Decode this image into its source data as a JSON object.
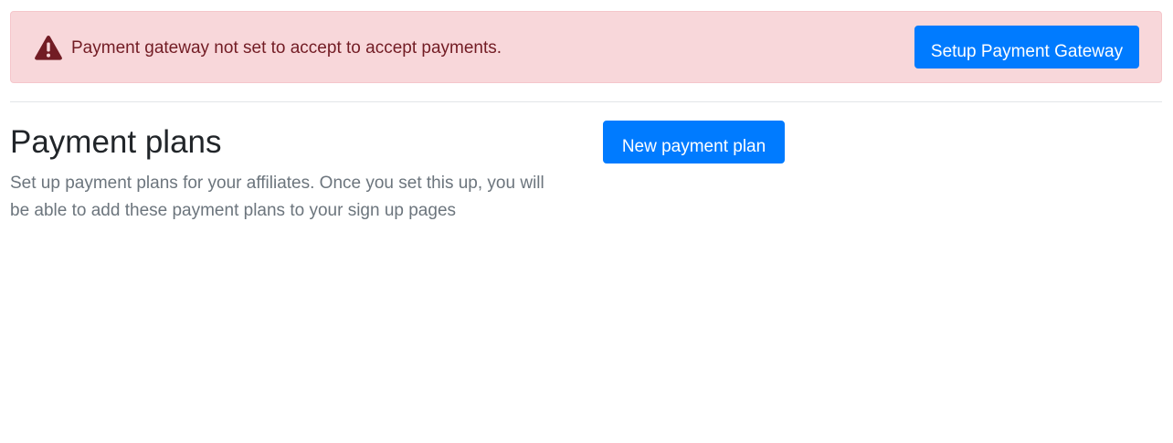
{
  "alert": {
    "message": "Payment gateway not set to accept to accept payments.",
    "icon": "warning-triangle-icon",
    "background_color": "#f8d7da",
    "text_color": "#721c24",
    "action_label": "Setup Payment Gateway"
  },
  "payment_plans": {
    "title": "Payment plans",
    "description": "Set up payment plans for your affiliates. Once you set this up, you will be able to add these payment plans to your sign up pages",
    "new_button_label": "New payment plan"
  },
  "colors": {
    "primary": "#007bff",
    "heading": "#212529",
    "muted": "#6c757d"
  }
}
